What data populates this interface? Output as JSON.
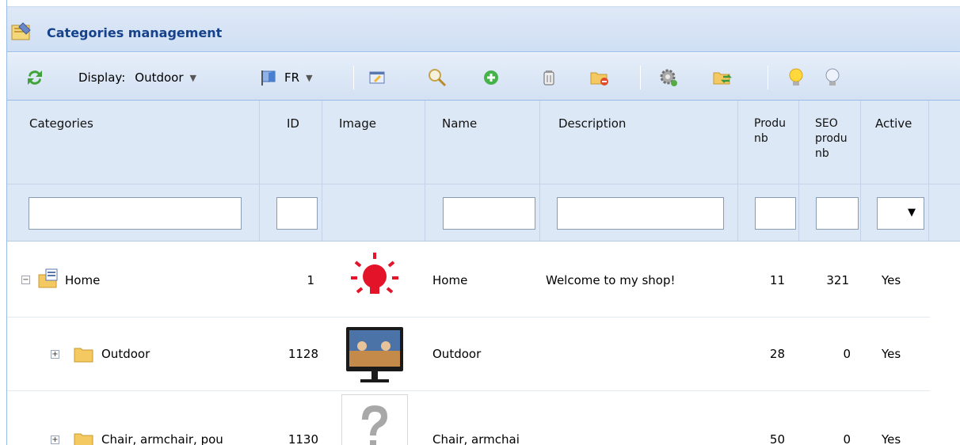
{
  "title": "Categories management",
  "toolbar": {
    "display_label": "Display:",
    "display_value": "Outdoor",
    "lang_value": "FR"
  },
  "columns": {
    "categories": "Categories",
    "id": "ID",
    "image": "Image",
    "name": "Name",
    "description": "Description",
    "prod_nb_line1": "Produ",
    "prod_nb_line2": "nb",
    "seo_line1": "SEO",
    "seo_line2": "produ",
    "seo_line3": "nb",
    "active": "Active"
  },
  "rows": [
    {
      "toggle": "−",
      "category": "Home",
      "id": "1",
      "image": "bulb-image",
      "name": "Home",
      "description": "Welcome to my shop!",
      "prod_nb": "11",
      "seo_nb": "321",
      "active": "Yes"
    },
    {
      "toggle": "+",
      "category": "Outdoor",
      "id": "1128",
      "image": "monitor-image",
      "name": "Outdoor",
      "description": "",
      "prod_nb": "28",
      "seo_nb": "0",
      "active": "Yes"
    },
    {
      "toggle": "+",
      "category": "Chair, armchair, pou",
      "id": "1130",
      "image": "question-image",
      "name": "Chair, armchai",
      "description": "",
      "prod_nb": "50",
      "seo_nb": "0",
      "active": "Yes"
    }
  ]
}
